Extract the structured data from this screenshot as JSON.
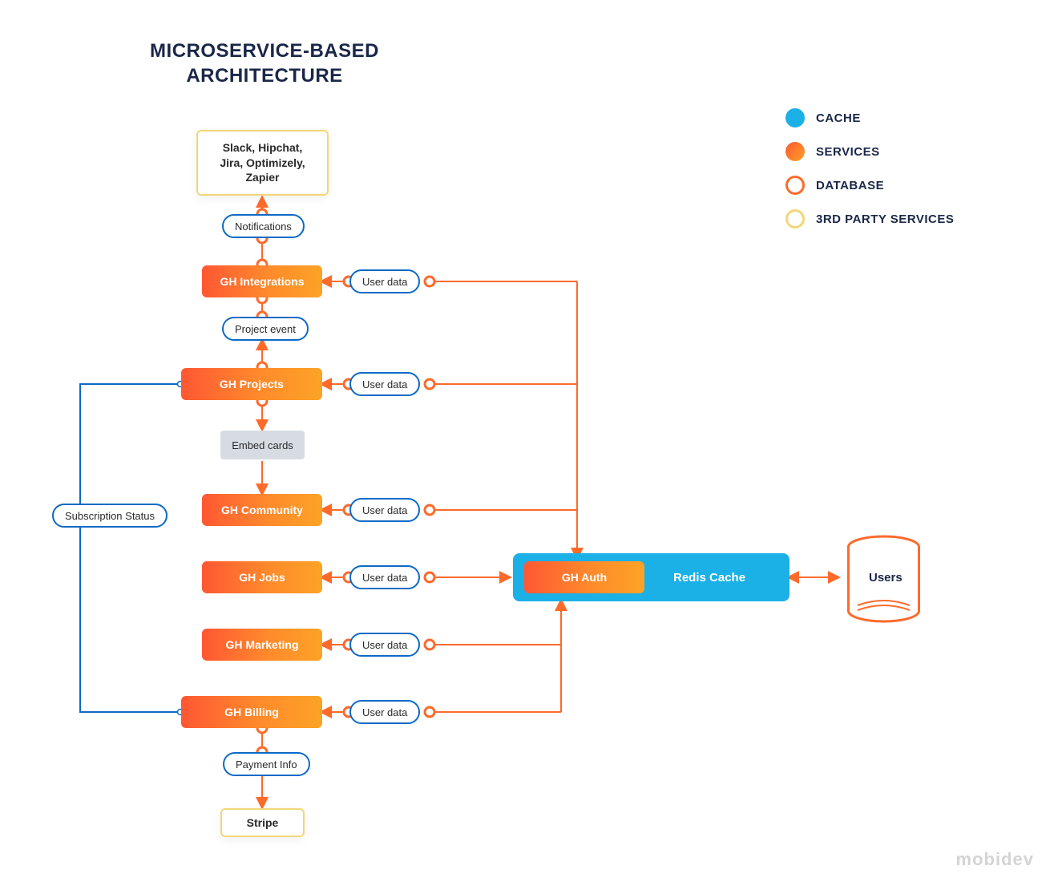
{
  "title_line1": "MICROSERVICE-BASED",
  "title_line2": "ARCHITECTURE",
  "third_party_top": "Slack, Hipchat,\nJira, Optimizely,\nZapier",
  "pills": {
    "notifications": "Notifications",
    "project_event": "Project event",
    "user_data": "User data",
    "subscription_status": "Subscription Status",
    "payment_info": "Payment Info"
  },
  "gray": {
    "embed_cards": "Embed cards"
  },
  "services": {
    "integrations": "GH Integrations",
    "projects": "GH Projects",
    "community": "GH Community",
    "jobs": "GH Jobs",
    "marketing": "GH Marketing",
    "billing": "GH Billing",
    "auth": "GH Auth"
  },
  "cache_label": "Redis Cache",
  "third_party_bottom": "Stripe",
  "db_label": "Users",
  "legend": {
    "cache": "CACHE",
    "services": "SERVICES",
    "database": "DATABASE",
    "third_party": "3RD PARTY SERVICES"
  },
  "brand": "mobidev",
  "colors": {
    "cache": "#1bb0e6",
    "service": "#ff6a2b",
    "db_ring": "#ff6a2b",
    "tp_ring": "#f2d778",
    "blue": "#0d6ac6"
  }
}
